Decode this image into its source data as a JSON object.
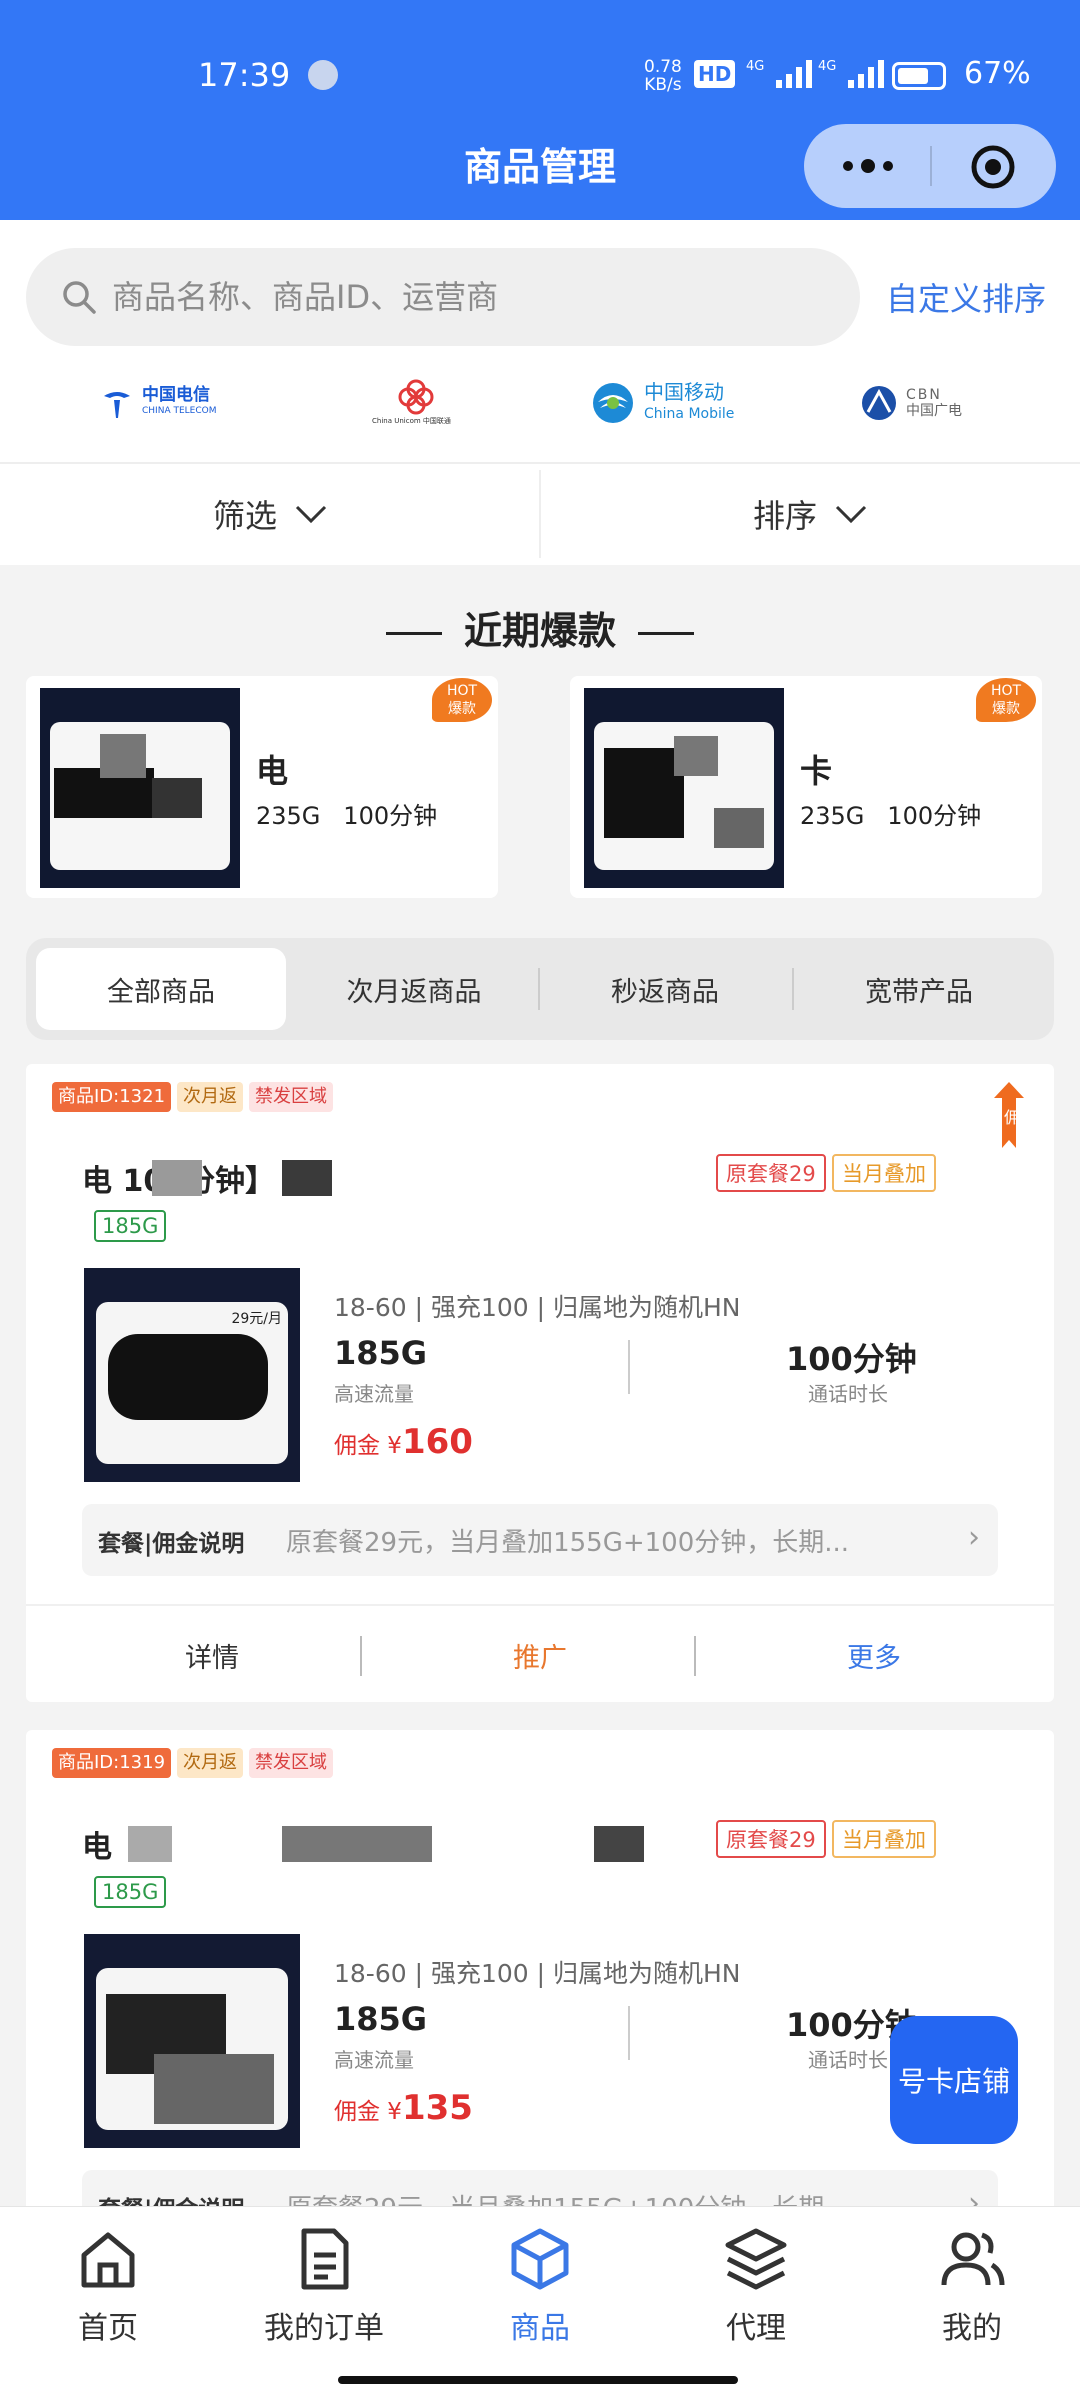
{
  "status_bar": {
    "time": "17:39",
    "net_speed": "0.78\nKB/s",
    "hd": "HD",
    "battery": "67%"
  },
  "nav": {
    "title": "商品管理"
  },
  "search": {
    "placeholder": "商品名称、商品ID、运营商",
    "custom_sort": "自定义排序"
  },
  "operators": [
    {
      "name": "中国电信",
      "sub": "CHINA TELECOM",
      "color": "#1a5cd6",
      "icon": "telecom-logo"
    },
    {
      "name": "China Unicom 中国联通",
      "sub": "",
      "color": "#e23a3a",
      "icon": "unicom-logo"
    },
    {
      "name": "中国移动",
      "sub": "China Mobile",
      "color": "#1d8ad6",
      "icon": "mobile-logo"
    },
    {
      "name": "中国广电",
      "sub": "CBN",
      "color": "#1b4fa8",
      "icon": "cbn-logo"
    }
  ],
  "filters": {
    "filter": "筛选",
    "sort": "排序"
  },
  "recent": {
    "title": "近期爆款",
    "items": [
      {
        "name": "电",
        "traffic": "235G",
        "minutes": "100分钟",
        "badge": "HOT\n爆款"
      },
      {
        "name": "卡",
        "traffic": "235G",
        "minutes": "100分钟",
        "badge": "HOT\n爆款"
      }
    ]
  },
  "tabs": [
    "全部商品",
    "次月返商品",
    "秒返商品",
    "宽带产品"
  ],
  "products": [
    {
      "id_tag": "商品ID:1321",
      "return_tag": "次月返",
      "area_tag": "禁发区域",
      "title": "电 100分钟】",
      "plan_tag": "原套餐29",
      "overlay_tag": "当月叠加",
      "gb_tag": "185G",
      "spec": "18-60 | 强充100 | 归属地为随机HN",
      "traffic": "185G",
      "traffic_label": "高速流量",
      "minutes": "100分钟",
      "minutes_label": "通话时长",
      "commission_label": "佣金 ¥",
      "commission": "160",
      "desc_label": "套餐|佣金说明",
      "desc": "原套餐29元，当月叠加155G+100分钟，长期...",
      "actions": [
        "详情",
        "推广",
        "更多"
      ],
      "corner": "佣"
    },
    {
      "id_tag": "商品ID:1319",
      "return_tag": "次月返",
      "area_tag": "禁发区域",
      "title": "电",
      "plan_tag": "原套餐29",
      "overlay_tag": "当月叠加",
      "gb_tag": "185G",
      "spec": "18-60 | 强充100 | 归属地为随机HN",
      "traffic": "185G",
      "traffic_label": "高速流量",
      "minutes": "100分钟",
      "minutes_label": "通话时长",
      "commission_label": "佣金 ¥",
      "commission": "135",
      "desc_label": "套餐|佣金说明",
      "desc": "原套餐29元，当月叠加155G+100分钟，长期..."
    }
  ],
  "fab": "号卡店铺",
  "tabbar": [
    {
      "label": "首页",
      "icon": "home-icon"
    },
    {
      "label": "我的订单",
      "icon": "order-icon"
    },
    {
      "label": "商品",
      "icon": "box-icon"
    },
    {
      "label": "代理",
      "icon": "layers-icon"
    },
    {
      "label": "我的",
      "icon": "users-icon"
    }
  ],
  "colors": {
    "brand": "#3377f6",
    "accent_text": "#3b78e6",
    "commission": "#e0302f",
    "promote": "#e8772e"
  }
}
